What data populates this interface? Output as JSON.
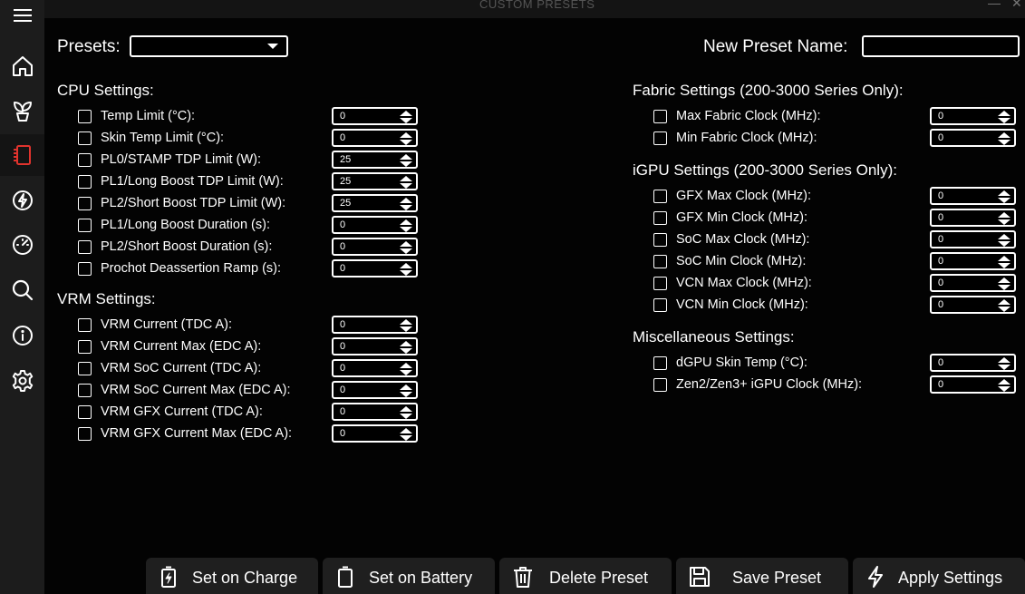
{
  "window": {
    "title": "CUSTOM PRESETS"
  },
  "sidebar": {
    "items": [
      {
        "icon": "hamburger-menu-icon"
      },
      {
        "icon": "home-icon"
      },
      {
        "icon": "plant-icon"
      },
      {
        "icon": "cpu-chip-icon",
        "active": true
      },
      {
        "icon": "lightning-icon"
      },
      {
        "icon": "speedometer-icon"
      },
      {
        "icon": "search-icon"
      },
      {
        "icon": "info-icon"
      },
      {
        "icon": "gear-icon"
      }
    ]
  },
  "header": {
    "presets_label": "Presets:",
    "presets_value": "",
    "new_preset_label": "New Preset Name:",
    "new_preset_value": ""
  },
  "cpu": {
    "title": "CPU Settings:",
    "items": [
      {
        "label": "Temp Limit (°C):",
        "value": "0"
      },
      {
        "label": "Skin Temp Limit (°C):",
        "value": "0"
      },
      {
        "label": "PL0/STAMP TDP Limit (W):",
        "value": "25"
      },
      {
        "label": "PL1/Long Boost TDP Limit (W):",
        "value": "25"
      },
      {
        "label": "PL2/Short Boost TDP Limit (W):",
        "value": "25"
      },
      {
        "label": "PL1/Long Boost Duration (s):",
        "value": "0"
      },
      {
        "label": "PL2/Short Boost Duration (s):",
        "value": "0"
      },
      {
        "label": "Prochot Deassertion Ramp (s):",
        "value": "0"
      }
    ]
  },
  "vrm": {
    "title": "VRM Settings:",
    "items": [
      {
        "label": "VRM Current (TDC A):",
        "value": "0"
      },
      {
        "label": "VRM Current Max (EDC A):",
        "value": "0"
      },
      {
        "label": "VRM SoC Current (TDC A):",
        "value": "0"
      },
      {
        "label": "VRM SoC Current Max (EDC A):",
        "value": "0"
      },
      {
        "label": "VRM GFX Current (TDC A):",
        "value": "0"
      },
      {
        "label": "VRM GFX Current Max (EDC A):",
        "value": "0"
      }
    ]
  },
  "fabric": {
    "title": "Fabric Settings (200-3000 Series Only):",
    "items": [
      {
        "label": "Max Fabric Clock (MHz):",
        "value": "0"
      },
      {
        "label": "Min Fabric Clock (MHz):",
        "value": "0"
      }
    ]
  },
  "igpu": {
    "title": "iGPU Settings (200-3000 Series Only):",
    "items": [
      {
        "label": "GFX Max Clock (MHz):",
        "value": "0"
      },
      {
        "label": "GFX Min Clock (MHz):",
        "value": "0"
      },
      {
        "label": "SoC Max Clock (MHz):",
        "value": "0"
      },
      {
        "label": "SoC Min Clock (MHz):",
        "value": "0"
      },
      {
        "label": "VCN Max Clock (MHz):",
        "value": "0"
      },
      {
        "label": "VCN Min Clock (MHz):",
        "value": "0"
      }
    ]
  },
  "misc": {
    "title": "Miscellaneous Settings:",
    "items": [
      {
        "label": "dGPU Skin Temp (°C):",
        "value": "0"
      },
      {
        "label": "Zen2/Zen3+ iGPU Clock (MHz):",
        "value": "0"
      }
    ]
  },
  "actions": {
    "set_on_charge": "Set on Charge",
    "set_on_battery": "Set on Battery",
    "delete_preset": "Delete Preset",
    "save_preset": "Save Preset",
    "apply_settings": "Apply Settings"
  }
}
